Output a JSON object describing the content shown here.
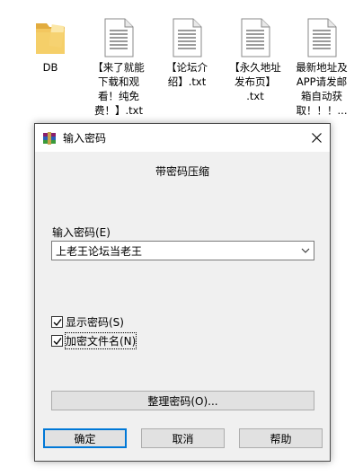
{
  "desktop": {
    "files": [
      {
        "label": "DB",
        "type": "folder"
      },
      {
        "label": "【来了就能\n下载和观\n看！纯免\n费！】.txt",
        "type": "txt"
      },
      {
        "label": "【论坛介\n绍】.txt",
        "type": "txt"
      },
      {
        "label": "【永久地址\n发布页】\n.txt",
        "type": "txt"
      },
      {
        "label": "最新地址及\nAPP请发邮\n箱自动获\n取！！！...",
        "type": "txt"
      }
    ]
  },
  "dialog": {
    "title": "输入密码",
    "subtitle": "带密码压缩",
    "password_label": "输入密码(E)",
    "password_value": "上老王论坛当老王",
    "show_password_label": "显示密码(S)",
    "show_password_checked": true,
    "encrypt_names_label": "加密文件名(N)",
    "encrypt_names_checked": true,
    "organize_button": "整理密码(O)...",
    "ok_button": "确定",
    "cancel_button": "取消",
    "help_button": "帮助"
  },
  "colors": {
    "folder": "#f3c75f",
    "default_button_border": "#0078d7",
    "dialog_bg": "#f0f0f0"
  }
}
